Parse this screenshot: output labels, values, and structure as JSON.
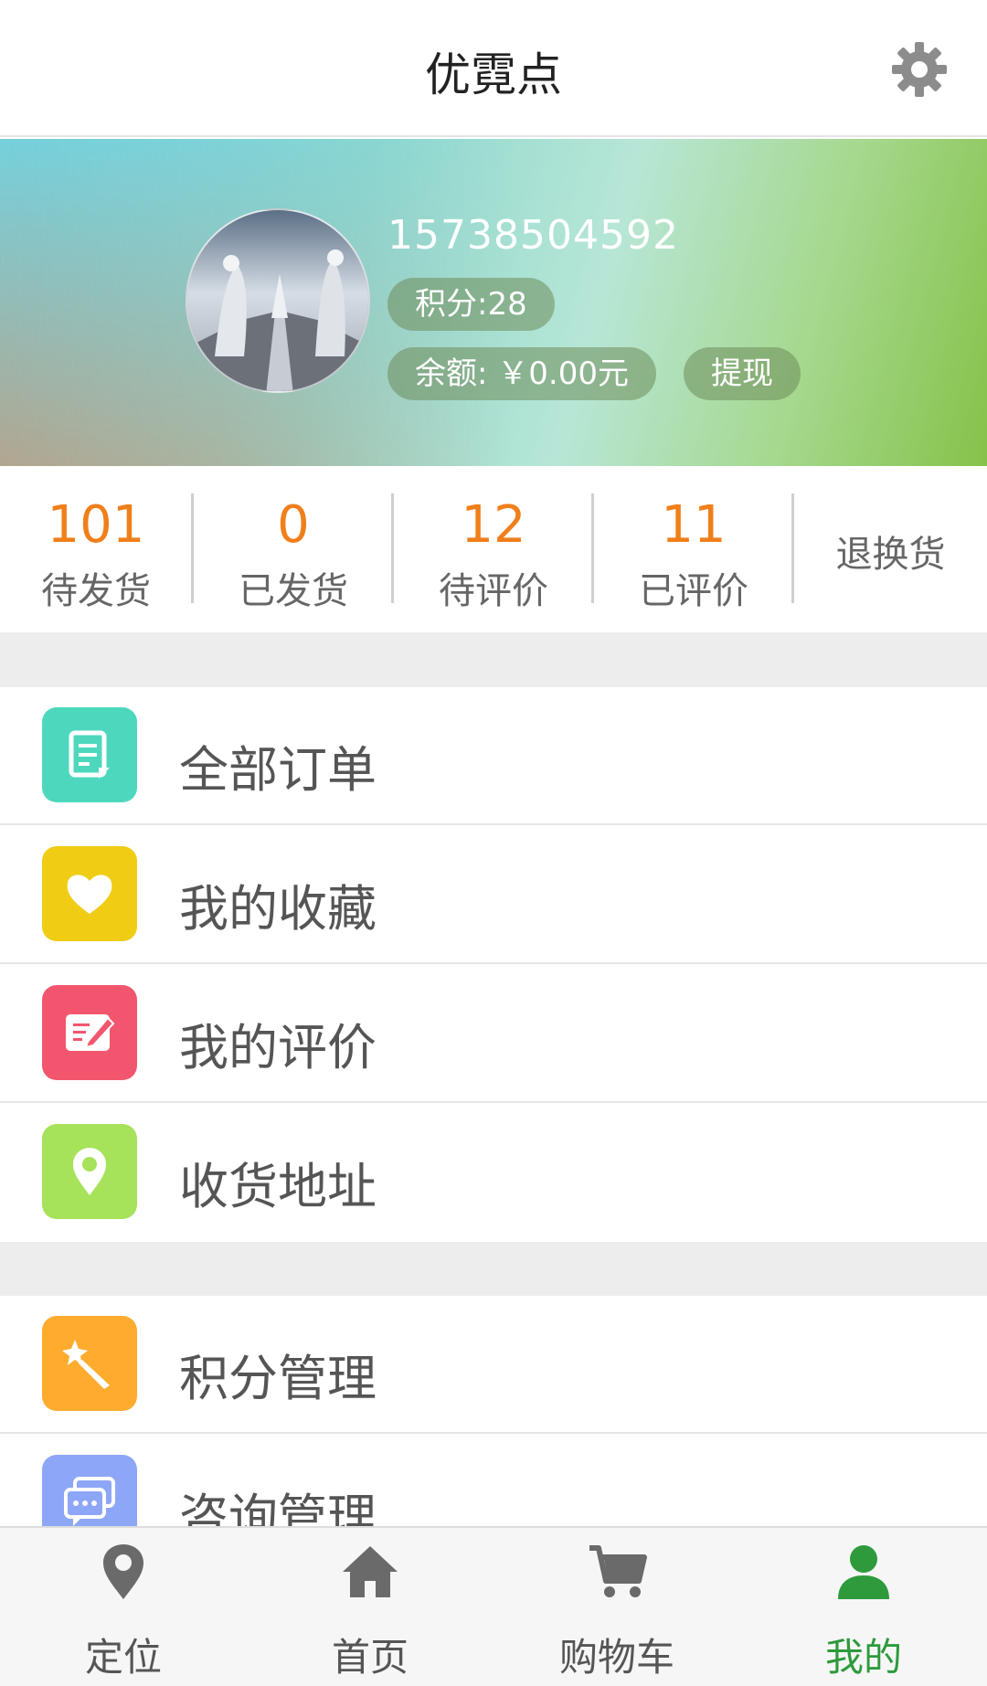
{
  "header": {
    "title": "优霓点",
    "settings_icon": "gear-icon"
  },
  "profile": {
    "phone": "15738504592",
    "points": "积分:28",
    "balance": "余额: ￥0.00元",
    "withdraw": "提现"
  },
  "order_stats": [
    {
      "count": "101",
      "label": "待发货"
    },
    {
      "count": "0",
      "label": "已发货"
    },
    {
      "count": "12",
      "label": "待评价"
    },
    {
      "count": "11",
      "label": "已评价"
    },
    {
      "label": "退换货"
    }
  ],
  "menu": [
    {
      "label": "全部订单",
      "icon": "document-icon",
      "color": "#4dd8bd"
    },
    {
      "label": "我的收藏",
      "icon": "heart-icon",
      "color": "#f0cc14"
    },
    {
      "label": "我的评价",
      "icon": "edit-icon",
      "color": "#f2566e"
    },
    {
      "label": "收货地址",
      "icon": "location-pin-icon",
      "color": "#a6e25a"
    },
    {
      "label": "积分管理",
      "icon": "magic-wand-icon",
      "color": "#ffab2e"
    },
    {
      "label": "咨询管理",
      "icon": "chat-icon",
      "color": "#8ea6f7"
    }
  ],
  "tabbar": [
    {
      "label": "定位",
      "icon": "location-pin-icon"
    },
    {
      "label": "首页",
      "icon": "home-icon"
    },
    {
      "label": "购物车",
      "icon": "cart-icon"
    },
    {
      "label": "我的",
      "icon": "user-icon",
      "active": true
    }
  ],
  "colors": {
    "accent_orange": "#f07f1a",
    "active_green": "#2e9a3c"
  }
}
